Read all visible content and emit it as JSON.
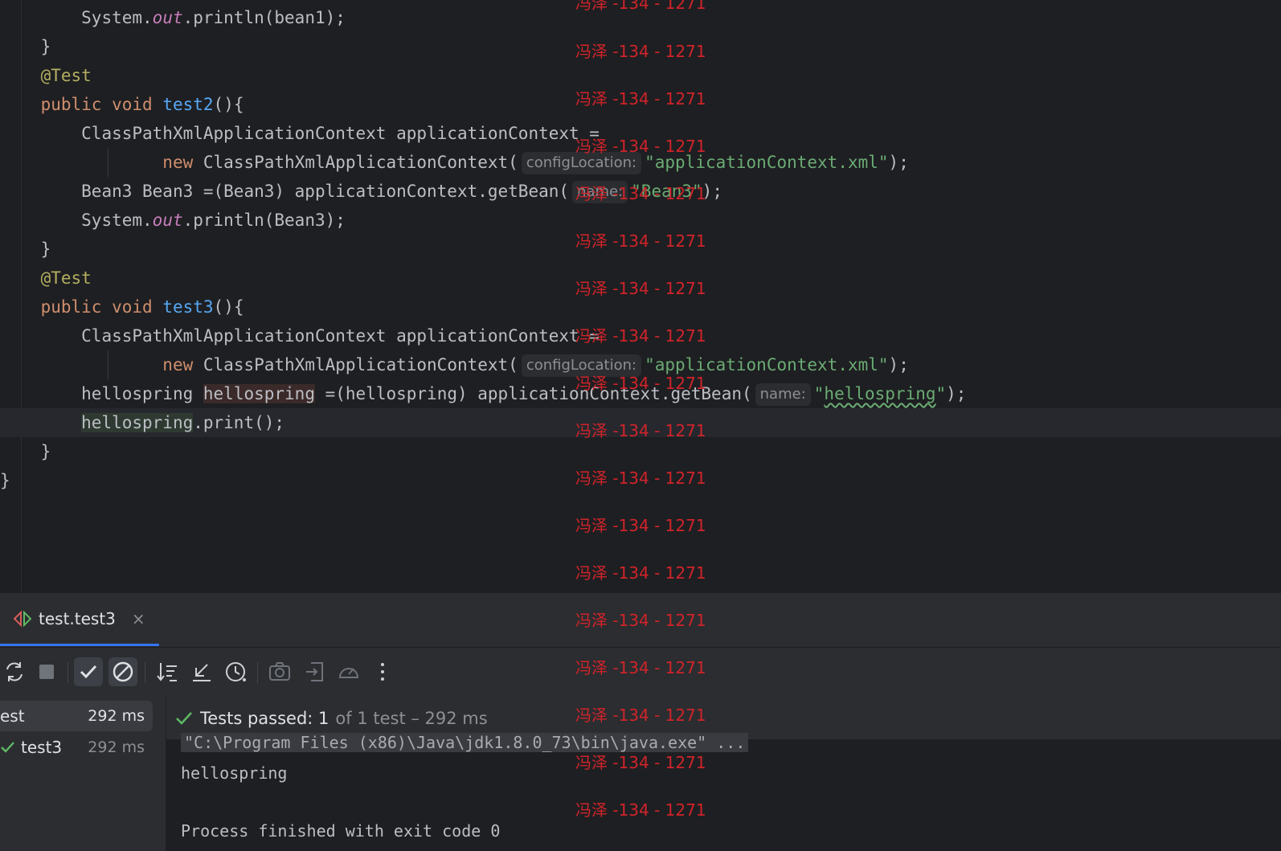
{
  "editor": {
    "lines": [
      {
        "text": "        System.out.println(bean1);"
      },
      {
        "text": "    }"
      },
      {
        "text": "    @Test"
      },
      {
        "text": "    public void test2(){"
      },
      {
        "text": "        ClassPathXmlApplicationContext applicationContext ="
      },
      {
        "text": "                new ClassPathXmlApplicationContext( configLocation: \"applicationContext.xml\");"
      },
      {
        "text": "        Bean3 Bean3 =(Bean3) applicationContext.getBean( name: \"Bean3\");"
      },
      {
        "text": "        System.out.println(Bean3);"
      },
      {
        "text": "    }"
      },
      {
        "text": "    @Test"
      },
      {
        "text": "    public void test3(){"
      },
      {
        "text": "        ClassPathXmlApplicationContext applicationContext ="
      },
      {
        "text": "                new ClassPathXmlApplicationContext( configLocation: \"applicationContext.xml\");"
      },
      {
        "text": "        hellospring hellospring =(hellospring) applicationContext.getBean( name: \"hellospring\");"
      },
      {
        "text": "        hellospring.print();"
      },
      {
        "text": "    }"
      },
      {
        "text": "}"
      }
    ],
    "tokens": {
      "system": "System",
      "out": "out",
      "println_bean1": ".println(bean1);",
      "println_bean3": ".println(Bean3);",
      "close_brace": "}",
      "annotation": "@Test",
      "kw_public": "public",
      "kw_void": "void",
      "fn_test2": "test2",
      "fn_test3": "test3",
      "parens_open": "(){",
      "ctx_decl": "ClassPathXmlApplicationContext applicationContext =",
      "kw_new": "new",
      "ctx_ctor": "ClassPathXmlApplicationContext(",
      "hint_config": "configLocation:",
      "str_xml": "\"applicationContext.xml\"",
      "end_paren": ");",
      "bean3_decl": "Bean3 Bean3 =(Bean3) applicationContext.getBean(",
      "hint_name": "name:",
      "str_bean3": "\"Bean3\"",
      "hs_type": "hellospring",
      "hs_var": "hellospring",
      "hs_cast": "=(hellospring) applicationContext.getBean(",
      "str_hs_q1": "\"",
      "str_hs": "hellospring",
      "str_hs_q2": "\"",
      "hs_print_var": "hellospring",
      "hs_print": ".print();"
    }
  },
  "watermark": {
    "text": "冯泽 -134 - 1271"
  },
  "run_panel": {
    "tab_label": "test.test3",
    "tab_close": "×",
    "toolbar": [
      {
        "name": "rerun-icon"
      },
      {
        "name": "stop-icon"
      },
      {
        "name": "show-passed-icon"
      },
      {
        "name": "show-ignored-icon"
      },
      {
        "name": "sort-icon"
      },
      {
        "name": "collapse-icon"
      },
      {
        "name": "history-icon"
      },
      {
        "name": "screenshot-icon"
      },
      {
        "name": "export-icon"
      },
      {
        "name": "coverage-icon"
      },
      {
        "name": "more-icon"
      }
    ],
    "tree": [
      {
        "label": "est",
        "time": "292 ms",
        "selected": true
      },
      {
        "label": "test3",
        "time": "292 ms",
        "selected": false
      }
    ],
    "status": {
      "main": "Tests passed: 1",
      "detail": "of 1 test – 292 ms"
    },
    "console": {
      "cmd": "\"C:\\Program Files (x86)\\Java\\jdk1.8.0_73\\bin\\java.exe\" ...",
      "output": "hellospring",
      "exit": "Process finished with exit code 0"
    }
  },
  "colors": {
    "keyword": "#cf8e6d",
    "annotation": "#b3ae60",
    "function": "#56a8f5",
    "string": "#6aab73",
    "field": "#c77dbb",
    "watermark": "#d0242a",
    "pass": "#5fb865"
  }
}
